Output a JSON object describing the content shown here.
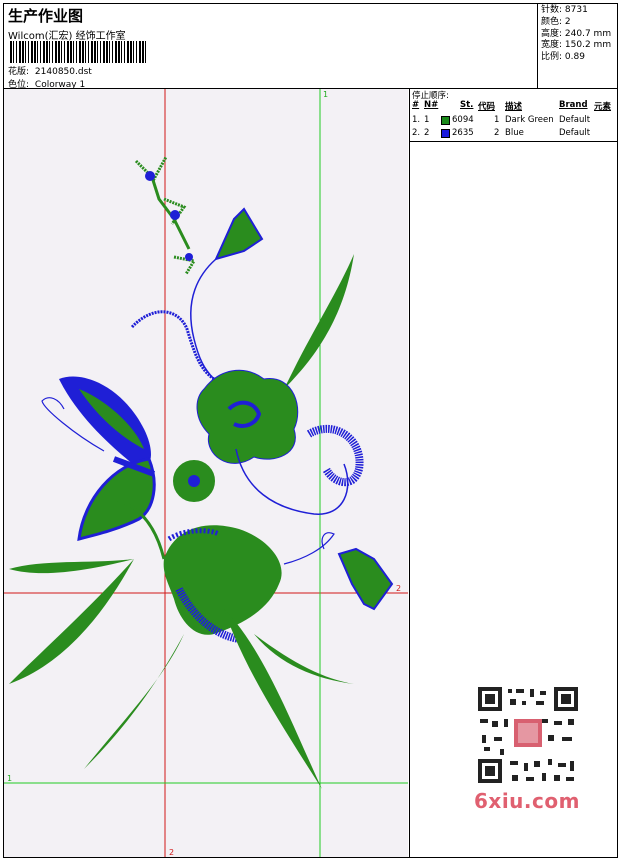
{
  "header": {
    "title": "生产作业图",
    "subtitle": "Wilcom(汇宏) 经饰工作室",
    "design_label": "花版:",
    "design_file": "2140850.dst",
    "colorway_label": "色位:",
    "colorway": "Colorway 1"
  },
  "stats": {
    "stitches_label": "针数:",
    "stitches": "8731",
    "colors_label": "颜色:",
    "colors": "2",
    "height_label": "高度:",
    "height": "240.7 mm",
    "width_label": "宽度:",
    "width": "150.2 mm",
    "scale_label": "比例:",
    "scale": "0.89"
  },
  "stop_sequence": {
    "title": "停止顺序:",
    "headers": [
      "#",
      "N#",
      "St.",
      "代码",
      "描述",
      "Brand",
      "元素"
    ],
    "rows": [
      {
        "num": "1.",
        "n": "1",
        "color": "#1a8a1a",
        "stitches": "6094",
        "code": "1",
        "desc": "Dark Green",
        "brand": "Default"
      },
      {
        "num": "2.",
        "n": "2",
        "color": "#1a1adc",
        "stitches": "2635",
        "code": "2",
        "desc": "Blue",
        "brand": "Default"
      }
    ]
  },
  "guides": {
    "v1_label": "1",
    "v2_label": "2",
    "h1_label": "1",
    "h2_label": "2"
  },
  "watermark": "6xiu.com",
  "colors": {
    "green": "#2a8c1e",
    "blue": "#1f1fd6",
    "red_guide": "#d01818",
    "green_guide": "#22cc22"
  }
}
